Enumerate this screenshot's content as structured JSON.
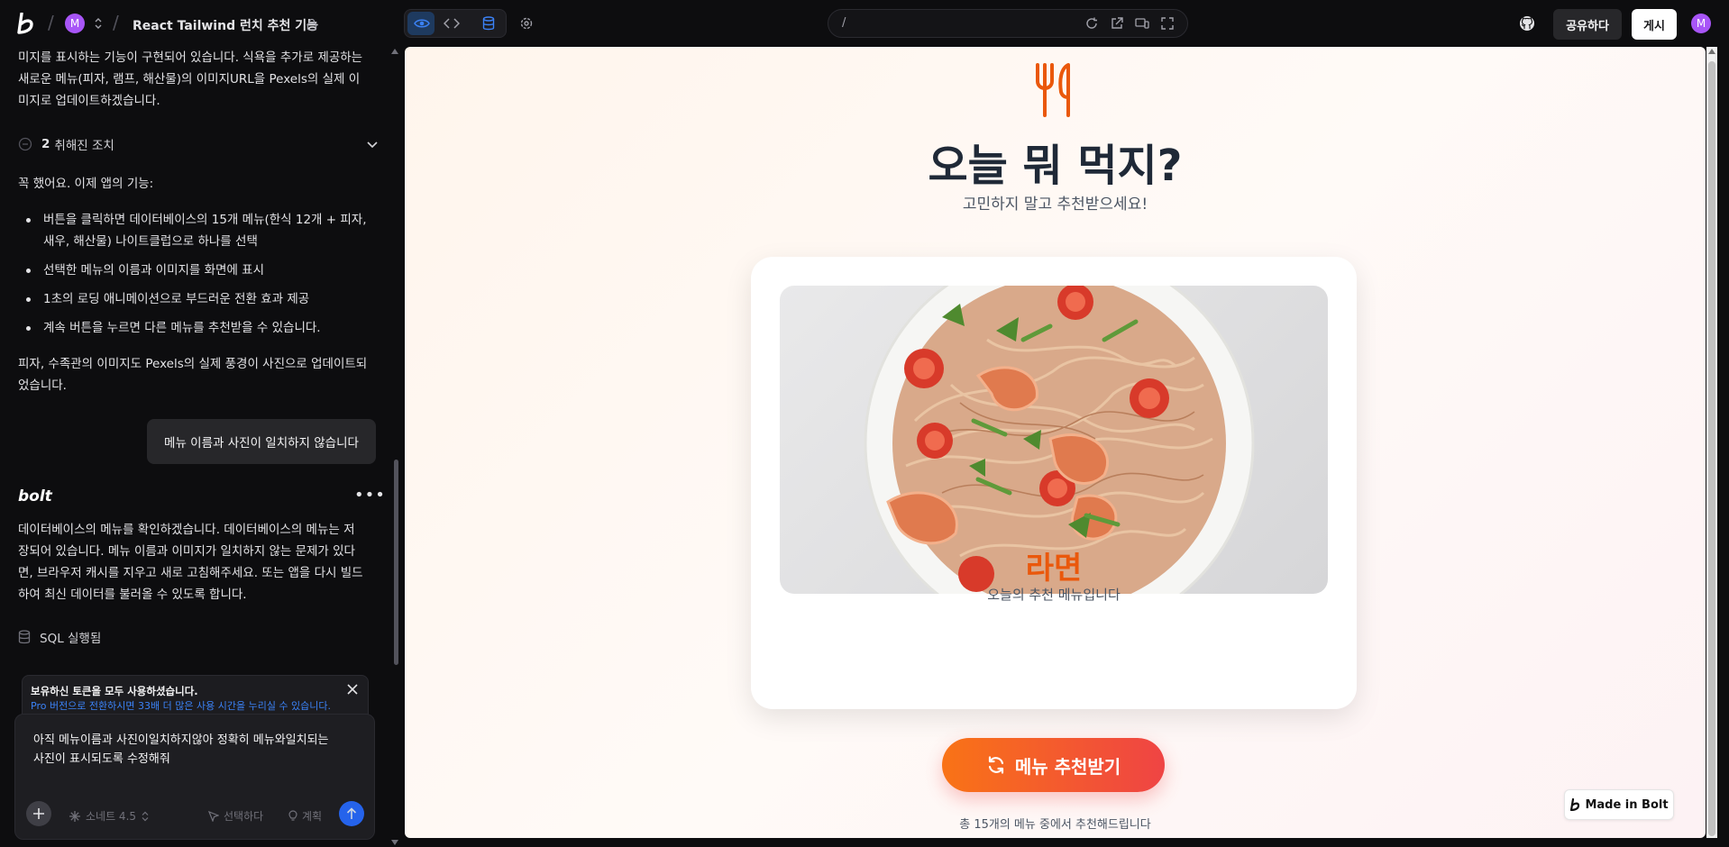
{
  "topbar": {
    "avatar_letter": "M",
    "project_title": "React Tailwind 런치 추천 기능",
    "url": "/",
    "share_label": "공유하다",
    "publish_label": "게시",
    "user_avatar_letter": "M"
  },
  "chat": {
    "intro_lines": [
      "미지를 표시하는 기능이 구현되어 있습니다. 식욕을 추가로 제공하는",
      "새로운 메뉴(피자, 램프, 해산물)의 이미지URL을 Pexels의 실제 이",
      "미지로 업데이트하겠습니다."
    ],
    "cancelled_count": "2",
    "cancelled_label": "취해진 조치",
    "done_text": "꼭 했어요. 이제 앱의 기능:",
    "features": [
      "버튼을 클릭하면 데이터베이스의 15개 메뉴(한식 12개 + 피자, 새우, 해산물) 나이트클럽으로 하나를 선택",
      "선택한 메뉴의 이름과 이미지를 화면에 표시",
      "1초의 로딩 애니메이션으로 부드러운 전환 효과 제공",
      "계속 버튼을 누르면 다른 메뉴를 추천받을 수 있습니다."
    ],
    "pizza_note_lines": [
      "피자, 수족관의 이미지도 Pexels의 실제 풍경이 사진으로 업데이트되",
      "었습니다."
    ],
    "user_message": "메뉴 이름과 사진이 일치하지 않습니다",
    "bolt_name": "bolt",
    "bolt_reply_lines": [
      "데이터베이스의 메뉴를 확인하겠습니다. 데이터베이스의 메뉴는 저",
      "장되어 있습니다. 메뉴 이름과 이미지가 일치하지 않는 문제가 있다",
      "면, 브라우저 캐시를 지우고 새로 고침해주세요. 또는 앱을 다시 빌드",
      "하여 최신 데이터를 불러올 수 있도록 합니다."
    ],
    "sql_label": "SQL 실행됨",
    "token_notice": "보유하신 토큰을 모두 사용하셨습니다.",
    "token_upgrade": "Pro 버전으로 전환하시면 33배 더 많은 사용 시간을 누리실 수 있습니다.",
    "input_lines": [
      "아직 메뉴이름과 사진이일치하지않아 정확히 메뉴와일치되는",
      "사진이 표시되도록 수정해줘"
    ],
    "model_label": "소네트 4.5",
    "select_label": "선택하다",
    "plan_label": "계획"
  },
  "app": {
    "heading": "오늘 뭐 먹지?",
    "subheading": "고민하지 말고 추천받으세요!",
    "menu_name": "라면",
    "menu_caption": "오늘의 추천 메뉴입니다",
    "button_label": "메뉴 추천받기",
    "footer": "총 15개의 메뉴 중에서 추천해드립니다",
    "made_in": "Made in Bolt"
  },
  "colors": {
    "accent_orange": "#ea580c",
    "button_gradient_start": "#f97316",
    "button_gradient_end": "#ef4444",
    "avatar": "#a855f7",
    "link_blue": "#3b82f6"
  }
}
